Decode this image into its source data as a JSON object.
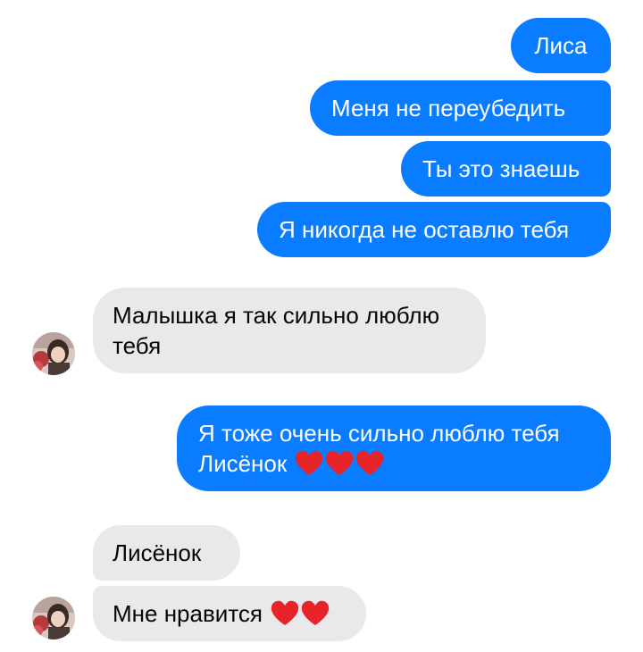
{
  "messages": {
    "sent_1": "Лиса",
    "sent_2": "Меня не переубедить",
    "sent_3": "Ты это знаешь",
    "sent_4": "Я никогда не оставлю тебя",
    "recv_1_line1": "Малышка я так сильно люблю",
    "recv_1_line2": "тебя",
    "sent_5_line1": "Я тоже очень сильно люблю тебя",
    "sent_5_line2": "Лисёнок",
    "recv_2": "Лисёнок",
    "recv_3": "Мне нравится"
  },
  "icons": {
    "heart": "red-heart-emoji",
    "avatar": "contact-avatar-photo"
  },
  "colors": {
    "sent_bubble": "#0a7cff",
    "received_bubble": "#e9e9eb",
    "heart": "#e8232a"
  }
}
